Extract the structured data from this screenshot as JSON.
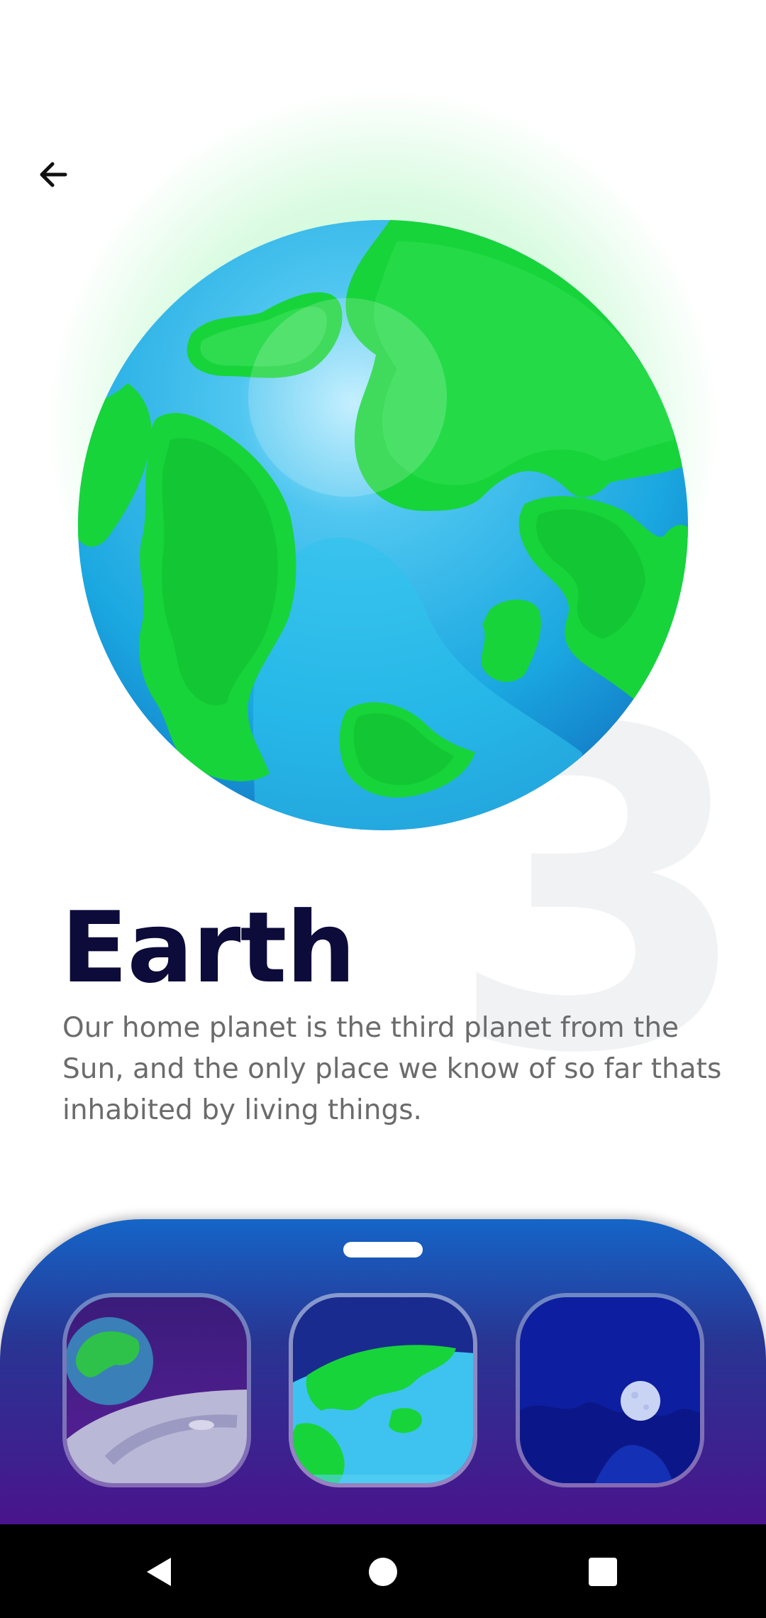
{
  "header": {
    "back_icon": "arrow-left-icon"
  },
  "planet": {
    "number": "3",
    "name": "Earth",
    "description": "Our home planet is the third planet from the Sun, and the only place we know of so far thats inhabited by living things.",
    "colors": {
      "ocean": "#22b5e8",
      "land": "#17d43a",
      "glow": "#6ef08c"
    }
  },
  "bottom_sheet": {
    "handle_icon": "drag-handle",
    "colors": {
      "top": "#1565c8",
      "bottom": "#4a148c"
    },
    "thumbnails": [
      {
        "name": "earth-from-moon",
        "icon": "moon-surface-earthrise"
      },
      {
        "name": "earth-surface",
        "icon": "earth-closeup",
        "selected": true
      },
      {
        "name": "moon-night",
        "icon": "moon-in-night-sky"
      }
    ]
  },
  "system_nav": {
    "back": "back-triangle-icon",
    "home": "home-circle-icon",
    "recents": "recents-square-icon"
  }
}
